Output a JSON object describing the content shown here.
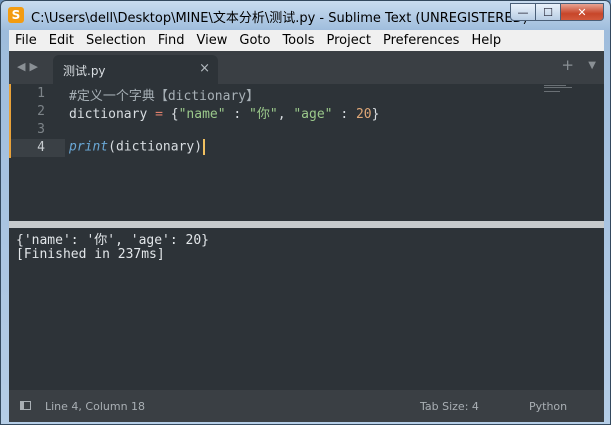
{
  "window": {
    "title": "C:\\Users\\dell\\Desktop\\MINE\\文本分析\\测试.py - Sublime Text (UNREGISTERED)",
    "app_icon": "S",
    "controls": {
      "minimize": "—",
      "maximize": "☐",
      "close": "✕"
    }
  },
  "menu": {
    "items": [
      "File",
      "Edit",
      "Selection",
      "Find",
      "View",
      "Goto",
      "Tools",
      "Project",
      "Preferences",
      "Help"
    ]
  },
  "tabs": {
    "nav_arrows": "◀▶",
    "active_tab": {
      "label": "测试.py",
      "close": "×"
    },
    "new_tab": "+",
    "dropdown": "▼"
  },
  "editor": {
    "line_numbers": [
      "1",
      "2",
      "3",
      "4"
    ],
    "active_line": 4,
    "code": {
      "line1": "#定义一个字典【dictionary】",
      "line2": {
        "var": "dictionary",
        "eq": " = ",
        "lbrace": "{",
        "k1": "\"name\"",
        "colon1": " : ",
        "v1": "\"你\"",
        "comma": ", ",
        "k2": "\"age\"",
        "colon2": " : ",
        "v2": "20",
        "rbrace": "}"
      },
      "line4": {
        "fn": "print",
        "open": "(",
        "arg": "dictionary",
        "close": ")"
      }
    }
  },
  "output": {
    "lines": [
      "{'name': '你', 'age': 20}",
      "[Finished in 237ms]"
    ]
  },
  "status": {
    "position": "Line 4, Column 18",
    "tab_size": "Tab Size: 4",
    "syntax": "Python"
  },
  "colors": {
    "editor_bg": "#2d3338",
    "string": "#9bc98b",
    "number": "#e0a877",
    "operator": "#e0806d",
    "function": "#6aa8d6"
  }
}
